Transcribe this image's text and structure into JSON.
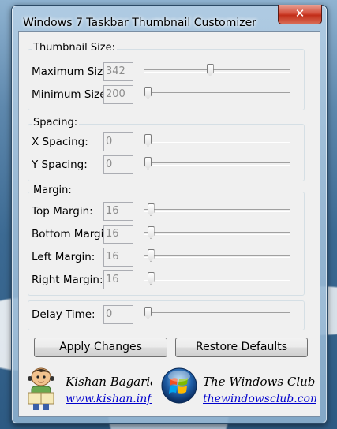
{
  "window": {
    "title": "Windows 7 Taskbar Thumbnail Customizer",
    "close_glyph": "✕"
  },
  "thumbnail_size": {
    "legend": "Thumbnail Size:",
    "rows": [
      {
        "label": "Maximum Size",
        "value": "342",
        "slider_level": 0.45
      },
      {
        "label": "Minimum Size",
        "value": "200",
        "slider_level": 0.0
      }
    ]
  },
  "spacing": {
    "legend": "Spacing:",
    "rows": [
      {
        "label": "X Spacing:",
        "value": "0",
        "slider_level": 0.0
      },
      {
        "label": "Y Spacing:",
        "value": "0",
        "slider_level": 0.0
      }
    ]
  },
  "margin": {
    "legend": "Margin:",
    "rows": [
      {
        "label": "Top Margin:",
        "value": "16",
        "slider_level": 0.02
      },
      {
        "label": "Bottom Margin:",
        "value": "16",
        "slider_level": 0.02
      },
      {
        "label": "Left Margin:",
        "value": "16",
        "slider_level": 0.02
      },
      {
        "label": "Right Margin:",
        "value": "16",
        "slider_level": 0.02
      }
    ]
  },
  "delay": {
    "label": "Delay Time:",
    "value": "0",
    "slider_level": 0.0
  },
  "buttons": {
    "apply": "Apply Changes",
    "restore": "Restore Defaults"
  },
  "footer": {
    "author_name": "Kishan Bagaria",
    "author_link": "www.kishan.info",
    "club_name": "The Windows Club",
    "club_link": "thewindowsclub.com"
  },
  "icons": {
    "close": "close-icon",
    "author_avatar": "cartoon-boy-reading-icon",
    "club_logo": "windows-orb-icon"
  },
  "colors": {
    "close_button": "#c8361f",
    "link": "#0000cc",
    "field_text": "#8c8c8c"
  }
}
